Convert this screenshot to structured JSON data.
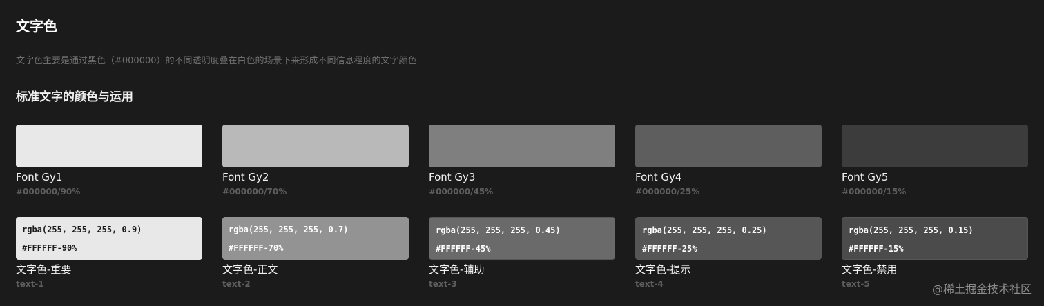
{
  "header": {
    "title": "文字色",
    "description": "文字色主要是通过黑色（#000000）的不同透明度叠在白色的场景下来形成不同信息程度的文字颜色",
    "subtitle": "标准文字的颜色与运用"
  },
  "font_swatches": [
    {
      "name": "Font Gy1",
      "code": "#000000/90%",
      "color": "#e8e8e8"
    },
    {
      "name": "Font Gy2",
      "code": "#000000/70%",
      "color": "#b9b9b9"
    },
    {
      "name": "Font Gy3",
      "code": "#000000/45%",
      "color": "#7f7f7f"
    },
    {
      "name": "Font Gy4",
      "code": "#000000/25%",
      "color": "#5e5e5e"
    },
    {
      "name": "Font Gy5",
      "code": "#000000/15%",
      "color": "#3c3c3c"
    }
  ],
  "text_swatches": [
    {
      "rgba": "rgba(255, 255, 255, 0.9)",
      "hex": "#FFFFFF-90%",
      "name": "文字色-重要",
      "code": "text-1",
      "color": "#e8e8e8",
      "text_color": "#1a1a1a"
    },
    {
      "rgba": "rgba(255, 255, 255, 0.7)",
      "hex": "#FFFFFF-70%",
      "name": "文字色-正文",
      "code": "text-2",
      "color": "#939393",
      "text_color": "#ffffff"
    },
    {
      "rgba": "rgba(255, 255, 255, 0.45)",
      "hex": "#FFFFFF-45%",
      "name": "文字色-辅助",
      "code": "text-3",
      "color": "#6a6a6a",
      "text_color": "#ffffff"
    },
    {
      "rgba": "rgba(255, 255, 255, 0.25)",
      "hex": "#FFFFFF-25%",
      "name": "文字色-提示",
      "code": "text-4",
      "color": "#565656",
      "text_color": "#ffffff"
    },
    {
      "rgba": "rgba(255, 255, 255, 0.15)",
      "hex": "#FFFFFF-15%",
      "name": "文字色-禁用",
      "code": "text-5",
      "color": "#4b4b4b",
      "text_color": "#ffffff"
    }
  ],
  "watermark": "@稀土掘金技术社区"
}
